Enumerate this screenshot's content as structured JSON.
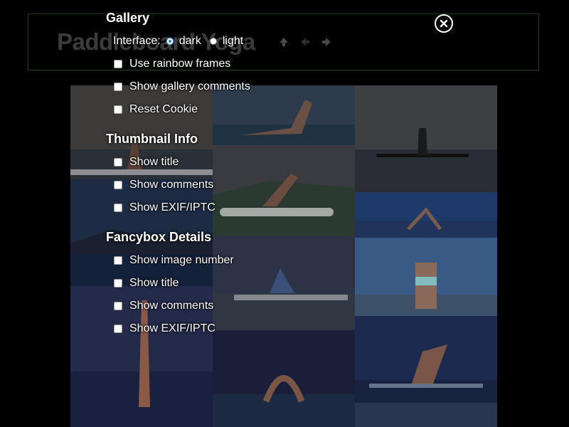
{
  "header": {
    "title": "Paddleboard Yoga"
  },
  "gallery_settings": {
    "title": "Gallery",
    "interface_label": "Interface:",
    "interface_options": [
      {
        "label": "dark",
        "selected": true
      },
      {
        "label": "light",
        "selected": false
      }
    ],
    "items": [
      "Use rainbow frames",
      "Show gallery comments",
      "Reset Cookie"
    ]
  },
  "thumbnail_info": {
    "title": "Thumbnail Info",
    "items": [
      "Show title",
      "Show comments",
      "Show EXIF/IPTC"
    ]
  },
  "fancybox_details": {
    "title": "Fancybox Details",
    "items": [
      "Show image number",
      "Show title",
      "Show comments",
      "Show EXIF/IPTC"
    ]
  },
  "icons": {
    "close": "close-icon",
    "nav": [
      "arrow-up-icon",
      "arrow-left-icon",
      "arrow-right-icon"
    ]
  },
  "colors": {
    "background": "#000000",
    "accent": "#3a7bd5",
    "border": "#1f3d1f"
  }
}
